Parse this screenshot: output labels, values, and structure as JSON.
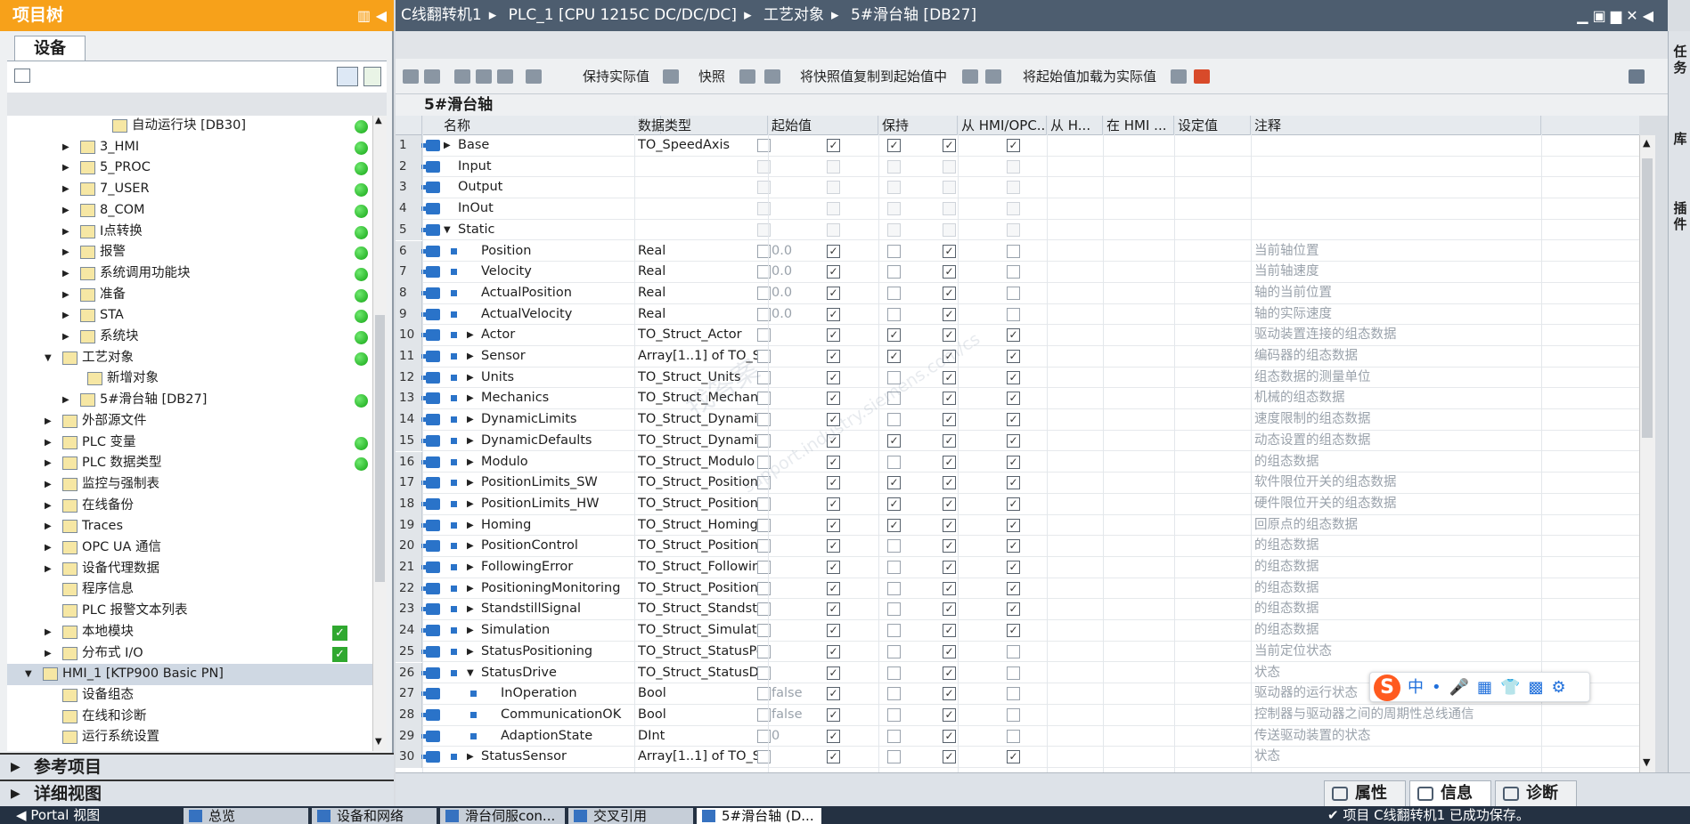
{
  "project_tree": {
    "title": "项目树",
    "device_tab": "设备",
    "items": [
      {
        "label": "自动运行块 [DB30]",
        "status": "ok"
      },
      {
        "label": "3_HMI",
        "status": "ok"
      },
      {
        "label": "5_PROC",
        "status": "ok"
      },
      {
        "label": "7_USER",
        "status": "ok"
      },
      {
        "label": "8_COM",
        "status": "ok"
      },
      {
        "label": "I点转换",
        "status": "ok"
      },
      {
        "label": "报警",
        "status": "ok"
      },
      {
        "label": "系统调用功能块",
        "status": "ok"
      },
      {
        "label": "准备",
        "status": "ok"
      },
      {
        "label": "STA",
        "status": "ok"
      },
      {
        "label": "系统块",
        "status": "ok"
      },
      {
        "label": "工艺对象",
        "status": "ok"
      },
      {
        "label": "新增对象",
        "status": "none"
      },
      {
        "label": "5#滑台轴 [DB27]",
        "status": "ok"
      },
      {
        "label": "外部源文件",
        "status": "none"
      },
      {
        "label": "PLC 变量",
        "status": "ok"
      },
      {
        "label": "PLC 数据类型",
        "status": "ok"
      },
      {
        "label": "监控与强制表",
        "status": "none"
      },
      {
        "label": "在线备份",
        "status": "none"
      },
      {
        "label": "Traces",
        "status": "none"
      },
      {
        "label": "OPC UA 通信",
        "status": "none"
      },
      {
        "label": "设备代理数据",
        "status": "none"
      },
      {
        "label": "程序信息",
        "status": "none"
      },
      {
        "label": "PLC 报警文本列表",
        "status": "none"
      },
      {
        "label": "本地模块",
        "status": "check"
      },
      {
        "label": "分布式 I/O",
        "status": "check"
      },
      {
        "label": "HMI_1 [KTP900 Basic PN]",
        "status": "none"
      },
      {
        "label": "设备组态",
        "status": "none"
      },
      {
        "label": "在线和诊断",
        "status": "none"
      },
      {
        "label": "运行系统设置",
        "status": "none"
      }
    ],
    "reference_projects": "参考项目",
    "detail_view": "详细视图"
  },
  "breadcrumb": [
    "C线翻转机1",
    "PLC_1 [CPU 1215C DC/DC/DC]",
    "工艺对象",
    "5#滑台轴 [DB27]"
  ],
  "toolbar": {
    "keep_actual": "保持实际值",
    "snapshot": "快照",
    "copy_snapshot": "将快照值复制到起始值中",
    "load_start": "将起始值加载为实际值"
  },
  "db_title": "5#滑台轴",
  "table": {
    "headers": [
      "名称",
      "数据类型",
      "起始值",
      "保持",
      "从 HMI/OPC...",
      "从 H...",
      "在 HMI ...",
      "设定值",
      "注释"
    ],
    "rows": [
      {
        "n": "1",
        "name": "Base",
        "type": "TO_SpeedAxis",
        "start": "",
        "comment": "",
        "cb": [
          0,
          1,
          1,
          1,
          1
        ]
      },
      {
        "n": "2",
        "name": "Input",
        "type": "",
        "start": "",
        "comment": "",
        "cb": [
          0,
          0,
          0,
          0,
          0
        ]
      },
      {
        "n": "3",
        "name": "Output",
        "type": "",
        "start": "",
        "comment": "",
        "cb": [
          0,
          0,
          0,
          0,
          0
        ]
      },
      {
        "n": "4",
        "name": "InOut",
        "type": "",
        "start": "",
        "comment": "",
        "cb": [
          0,
          0,
          0,
          0,
          0
        ]
      },
      {
        "n": "5",
        "name": "Static",
        "type": "",
        "start": "",
        "comment": "",
        "cb": [
          0,
          0,
          0,
          0,
          0
        ]
      },
      {
        "n": "6",
        "name": "Position",
        "type": "Real",
        "start": "0.0",
        "comment": "当前轴位置",
        "cb": [
          0,
          1,
          0,
          1,
          0
        ]
      },
      {
        "n": "7",
        "name": "Velocity",
        "type": "Real",
        "start": "0.0",
        "comment": "当前轴速度",
        "cb": [
          0,
          1,
          0,
          1,
          0
        ]
      },
      {
        "n": "8",
        "name": "ActualPosition",
        "type": "Real",
        "start": "0.0",
        "comment": "轴的当前位置",
        "cb": [
          0,
          1,
          0,
          1,
          0
        ]
      },
      {
        "n": "9",
        "name": "ActualVelocity",
        "type": "Real",
        "start": "0.0",
        "comment": "轴的实际速度",
        "cb": [
          0,
          1,
          0,
          1,
          0
        ]
      },
      {
        "n": "10",
        "name": "Actor",
        "type": "TO_Struct_Actor",
        "start": "",
        "comment": "驱动装置连接的组态数据",
        "cb": [
          0,
          1,
          1,
          1,
          1
        ]
      },
      {
        "n": "11",
        "name": "Sensor",
        "type": "Array[1..1] of TO_S...",
        "start": "",
        "comment": "编码器的组态数据",
        "cb": [
          0,
          1,
          1,
          1,
          1
        ]
      },
      {
        "n": "12",
        "name": "Units",
        "type": "TO_Struct_Units",
        "start": "",
        "comment": "组态数据的测量单位",
        "cb": [
          0,
          1,
          0,
          1,
          1
        ]
      },
      {
        "n": "13",
        "name": "Mechanics",
        "type": "TO_Struct_Mechani...",
        "start": "",
        "comment": "机械的组态数据",
        "cb": [
          0,
          1,
          0,
          1,
          1
        ]
      },
      {
        "n": "14",
        "name": "DynamicLimits",
        "type": "TO_Struct_Dynami...",
        "start": "",
        "comment": "速度限制的组态数据",
        "cb": [
          0,
          1,
          0,
          1,
          1
        ]
      },
      {
        "n": "15",
        "name": "DynamicDefaults",
        "type": "TO_Struct_Dynami...",
        "start": "",
        "comment": "动态设置的组态数据",
        "cb": [
          0,
          1,
          1,
          1,
          1
        ]
      },
      {
        "n": "16",
        "name": "Modulo",
        "type": "TO_Struct_Modulo",
        "start": "",
        "comment": "的组态数据",
        "cb": [
          0,
          1,
          0,
          1,
          1
        ]
      },
      {
        "n": "17",
        "name": "PositionLimits_SW",
        "type": "TO_Struct_Position...",
        "start": "",
        "comment": "软件限位开关的组态数据",
        "cb": [
          0,
          1,
          1,
          1,
          1
        ]
      },
      {
        "n": "18",
        "name": "PositionLimits_HW",
        "type": "TO_Struct_Position...",
        "start": "",
        "comment": "硬件限位开关的组态数据",
        "cb": [
          0,
          1,
          1,
          1,
          1
        ]
      },
      {
        "n": "19",
        "name": "Homing",
        "type": "TO_Struct_Homing",
        "start": "",
        "comment": "回原点的组态数据",
        "cb": [
          0,
          1,
          1,
          1,
          1
        ]
      },
      {
        "n": "20",
        "name": "PositionControl",
        "type": "TO_Struct_Position...",
        "start": "",
        "comment": "的组态数据",
        "cb": [
          0,
          1,
          0,
          1,
          1
        ]
      },
      {
        "n": "21",
        "name": "FollowingError",
        "type": "TO_Struct_Followin...",
        "start": "",
        "comment": "的组态数据",
        "cb": [
          0,
          1,
          0,
          1,
          1
        ]
      },
      {
        "n": "22",
        "name": "PositioningMonitoring",
        "type": "TO_Struct_Positioni...",
        "start": "",
        "comment": "的组态数据",
        "cb": [
          0,
          1,
          0,
          1,
          1
        ]
      },
      {
        "n": "23",
        "name": "StandstillSignal",
        "type": "TO_Struct_Standstil...",
        "start": "",
        "comment": "的组态数据",
        "cb": [
          0,
          1,
          0,
          1,
          1
        ]
      },
      {
        "n": "24",
        "name": "Simulation",
        "type": "TO_Struct_Simulati...",
        "start": "",
        "comment": "的组态数据",
        "cb": [
          0,
          1,
          0,
          1,
          1
        ]
      },
      {
        "n": "25",
        "name": "StatusPositioning",
        "type": "TO_Struct_StatusPo...",
        "start": "",
        "comment": "当前定位状态",
        "cb": [
          0,
          1,
          0,
          1,
          0
        ]
      },
      {
        "n": "26",
        "name": "StatusDrive",
        "type": "TO_Struct_StatusDr...",
        "start": "",
        "comment": "状态",
        "cb": [
          0,
          1,
          0,
          1,
          0
        ]
      },
      {
        "n": "27",
        "name": "InOperation",
        "type": "Bool",
        "start": "false",
        "comment": "驱动器的运行状态",
        "cb": [
          0,
          1,
          0,
          1,
          0
        ]
      },
      {
        "n": "28",
        "name": "CommunicationOK",
        "type": "Bool",
        "start": "false",
        "comment": "控制器与驱动器之间的周期性总线通信",
        "cb": [
          0,
          1,
          0,
          1,
          0
        ]
      },
      {
        "n": "29",
        "name": "AdaptionState",
        "type": "DInt",
        "start": "0",
        "comment": "传送驱动装置的状态",
        "cb": [
          0,
          1,
          0,
          1,
          0
        ]
      },
      {
        "n": "30",
        "name": "StatusSensor",
        "type": "Array[1..1] of TO_S...",
        "start": "",
        "comment": "状态",
        "cb": [
          0,
          1,
          0,
          1,
          1
        ]
      }
    ]
  },
  "right_sidebar": [
    "任务",
    "库",
    "插件"
  ],
  "inspector_tabs": [
    "属性",
    "信息",
    "诊断"
  ],
  "taskbar": {
    "portal": "Portal 视图",
    "items": [
      "总览",
      "设备和网络",
      "滑台伺服con...",
      "交叉引用",
      "5#滑台轴 (D..."
    ],
    "status": "项目 C线翻转机1 已成功保存。"
  },
  "watermark": [
    "找答案",
    "support.industry.siemens.com/cs"
  ],
  "colors": {
    "tree_header": "#f7a11a",
    "breadcrumb_bar": "#4d5d6f",
    "status_ok": "#14a514",
    "accent_blue": "#2a73c9"
  }
}
